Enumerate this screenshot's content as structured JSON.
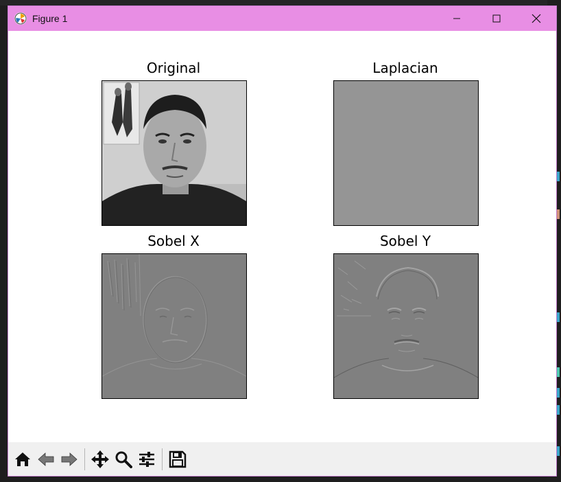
{
  "window": {
    "title": "Figure 1",
    "title_bar_color": "#e88ee4",
    "app_icon": "matplotlib-icon"
  },
  "window_controls": {
    "minimize_icon": "minimize-icon",
    "maximize_icon": "maximize-icon",
    "close_icon": "close-icon"
  },
  "subplots": [
    {
      "title": "Original",
      "image": "grayscale portrait photo"
    },
    {
      "title": "Laplacian",
      "image": "flat gray"
    },
    {
      "title": "Sobel X",
      "image": "embossed edge map"
    },
    {
      "title": "Sobel Y",
      "image": "embossed edge map"
    }
  ],
  "toolbar": {
    "buttons": [
      {
        "name": "home",
        "icon": "home-icon"
      },
      {
        "name": "back",
        "icon": "back-arrow-icon"
      },
      {
        "name": "forward",
        "icon": "forward-arrow-icon"
      },
      {
        "name": "pan",
        "icon": "move-icon"
      },
      {
        "name": "zoom",
        "icon": "zoom-icon"
      },
      {
        "name": "configure-subplots",
        "icon": "sliders-icon"
      },
      {
        "name": "save",
        "icon": "save-icon"
      }
    ]
  }
}
